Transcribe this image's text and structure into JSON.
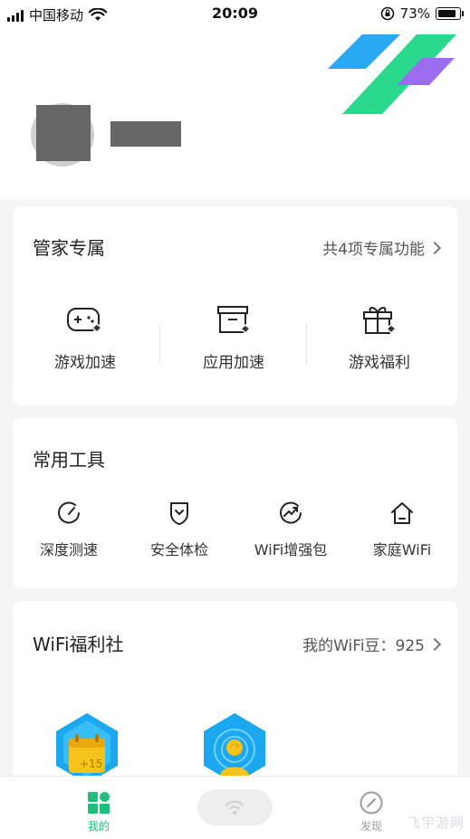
{
  "status_bar": {
    "carrier": "中国移动",
    "time": "20:09",
    "battery_text": "73%",
    "battery_level": 0.73
  },
  "vip_card": {
    "title": "管家专属",
    "link": "共4项专属功能",
    "items": [
      {
        "label": "游戏加速",
        "icon": "gamepad-icon"
      },
      {
        "label": "应用加速",
        "icon": "app-box-icon"
      },
      {
        "label": "游戏福利",
        "icon": "gift-icon"
      }
    ]
  },
  "tools_card": {
    "title": "常用工具",
    "items": [
      {
        "label": "深度测速",
        "icon": "speedometer-icon"
      },
      {
        "label": "安全体检",
        "icon": "shield-icon"
      },
      {
        "label": "WiFi增强包",
        "icon": "boost-chart-icon"
      },
      {
        "label": "家庭WiFi",
        "icon": "home-icon"
      }
    ]
  },
  "welfare_card": {
    "title": "WiFi福利社",
    "link": "我的WiFi豆：925",
    "badge_text": "+15"
  },
  "bottom_nav": {
    "items": [
      {
        "label": "我的",
        "icon": "grid-apps-icon",
        "active": true
      },
      {
        "label": "",
        "icon": "wifi-icon",
        "active": false
      },
      {
        "label": "发现",
        "icon": "compass-icon",
        "active": false
      }
    ]
  },
  "watermark": "飞宇游网",
  "colors": {
    "accent_green": "#1fbf7a",
    "logo_blue": "#2aa8f2",
    "logo_purple": "#9c6cf0",
    "logo_green": "#2bd98e",
    "badge_blue": "#1ba8f0",
    "badge_yellow": "#f6c21c"
  }
}
